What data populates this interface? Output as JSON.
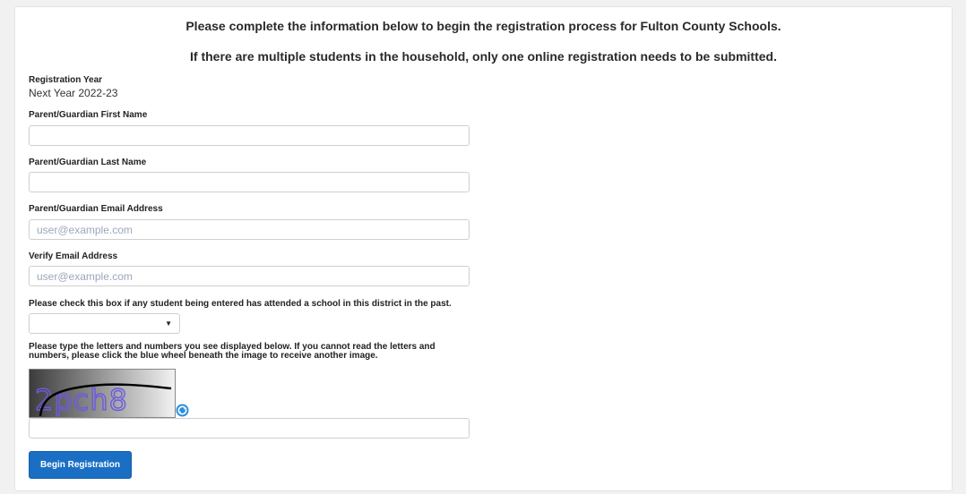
{
  "header": {
    "line1": "Please complete the information below to begin the registration process for Fulton County Schools.",
    "line2": "If there are multiple students in the household, only one online registration needs to be submitted."
  },
  "form": {
    "registration_year": {
      "label": "Registration Year",
      "value": "Next Year 2022-23"
    },
    "first_name": {
      "label": "Parent/Guardian First Name",
      "value": "",
      "placeholder": ""
    },
    "last_name": {
      "label": "Parent/Guardian Last Name",
      "value": "",
      "placeholder": ""
    },
    "email": {
      "label": "Parent/Guardian Email Address",
      "value": "",
      "placeholder": "user@example.com"
    },
    "verify_email": {
      "label": "Verify Email Address",
      "value": "",
      "placeholder": "user@example.com"
    },
    "attended": {
      "label": "Please check this box if any student being entered has attended a school in this district in the past.",
      "selected": ""
    },
    "captcha": {
      "instructions": "Please type the letters and numbers you see displayed below. If you cannot read the letters and numbers, please click the blue wheel beneath the image to receive another image.",
      "image_text": "2pch8",
      "value": ""
    },
    "submit_label": "Begin Registration"
  },
  "colors": {
    "button": "#1a6fc4",
    "refresh": "#2b8fdf"
  }
}
